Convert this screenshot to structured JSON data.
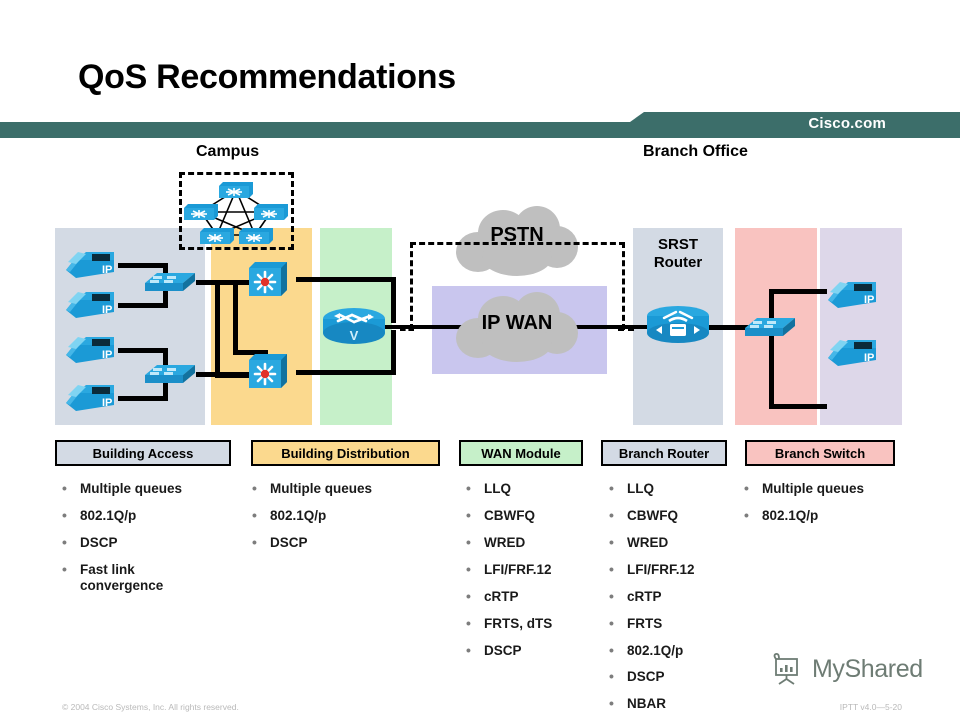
{
  "slide": {
    "title": "QoS Recommendations",
    "brand": "Cisco.com",
    "watermark": "MyShared",
    "footer_left": "© 2004 Cisco Systems, Inc. All rights reserved.",
    "footer_right": "IPTT v4.0—5-20"
  },
  "sections": {
    "campus": "Campus",
    "branch": "Branch Office"
  },
  "diagram": {
    "clouds": [
      {
        "name": "pstn",
        "label": "PSTN"
      },
      {
        "name": "ip-wan",
        "label": "IP WAN"
      }
    ],
    "srst_router": {
      "line1": "SRST",
      "line2": "Router"
    },
    "phone_label": "IP",
    "bands": [
      {
        "name": "building-access",
        "color": "#d3dae4"
      },
      {
        "name": "building-distribution",
        "color": "#fbd98e"
      },
      {
        "name": "wan-module",
        "color": "#c6f0c9"
      },
      {
        "name": "ip-wan",
        "color": "#c9c6ee"
      },
      {
        "name": "srst-router",
        "color": "#d3dae4"
      },
      {
        "name": "branch-switch",
        "color": "#f9c3c0"
      },
      {
        "name": "branch-phones",
        "color": "#ddd7e9"
      }
    ]
  },
  "legend_boxes": [
    {
      "name": "building-access",
      "label": "Building Access",
      "color": "#d3dae4"
    },
    {
      "name": "building-distribution",
      "label": "Building Distribution",
      "color": "#fbd98e"
    },
    {
      "name": "wan-module",
      "label": "WAN Module",
      "color": "#c6f0c9"
    },
    {
      "name": "branch-router",
      "label": "Branch Router",
      "color": "#d3dae4"
    },
    {
      "name": "branch-switch",
      "label": "Branch  Switch",
      "color": "#f9c3c0"
    }
  ],
  "columns": [
    {
      "name": "building-access",
      "items": [
        "Multiple queues",
        "802.1Q/p",
        "DSCP",
        "Fast link convergence"
      ]
    },
    {
      "name": "building-distribution",
      "items": [
        "Multiple queues",
        "802.1Q/p",
        "DSCP"
      ]
    },
    {
      "name": "wan-module",
      "items": [
        "LLQ",
        "CBWFQ",
        "WRED",
        "LFI/FRF.12",
        "cRTP",
        "FRTS, dTS",
        "DSCP"
      ]
    },
    {
      "name": "branch-router",
      "items": [
        "LLQ",
        "CBWFQ",
        "WRED",
        "LFI/FRF.12",
        "cRTP",
        "FRTS",
        "802.1Q/p",
        "DSCP",
        "NBAR"
      ]
    },
    {
      "name": "branch-switch",
      "items": [
        "Multiple queues",
        "802.1Q/p"
      ]
    }
  ],
  "colors": {
    "banner": "#3c6e6a",
    "cisco_blue": "#1b9ad6",
    "cloud_gray": "#bfbfbf",
    "wire": "#000000"
  }
}
